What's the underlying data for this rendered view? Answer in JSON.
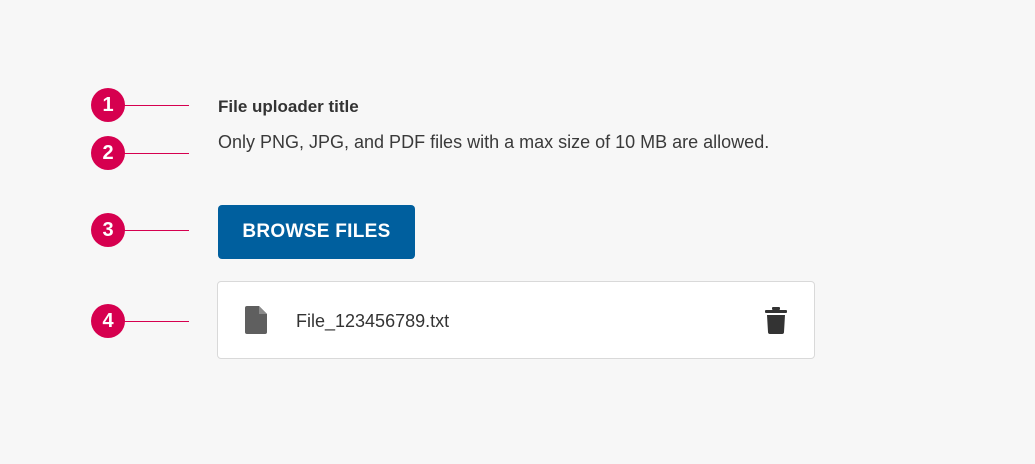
{
  "callouts": [
    {
      "number": "1"
    },
    {
      "number": "2"
    },
    {
      "number": "3"
    },
    {
      "number": "4"
    }
  ],
  "uploader": {
    "title": "File uploader title",
    "description": "Only PNG, JPG, and PDF files with a max size of 10 MB are allowed.",
    "browse_button_label": "BROWSE FILES",
    "files": [
      {
        "name": "File_123456789.txt",
        "icon": "file-icon",
        "action_icon": "trash-icon"
      }
    ]
  },
  "colors": {
    "background": "#f7f7f7",
    "callout": "#d6004f",
    "primary_button": "#005f9e",
    "icon": "#555555"
  }
}
